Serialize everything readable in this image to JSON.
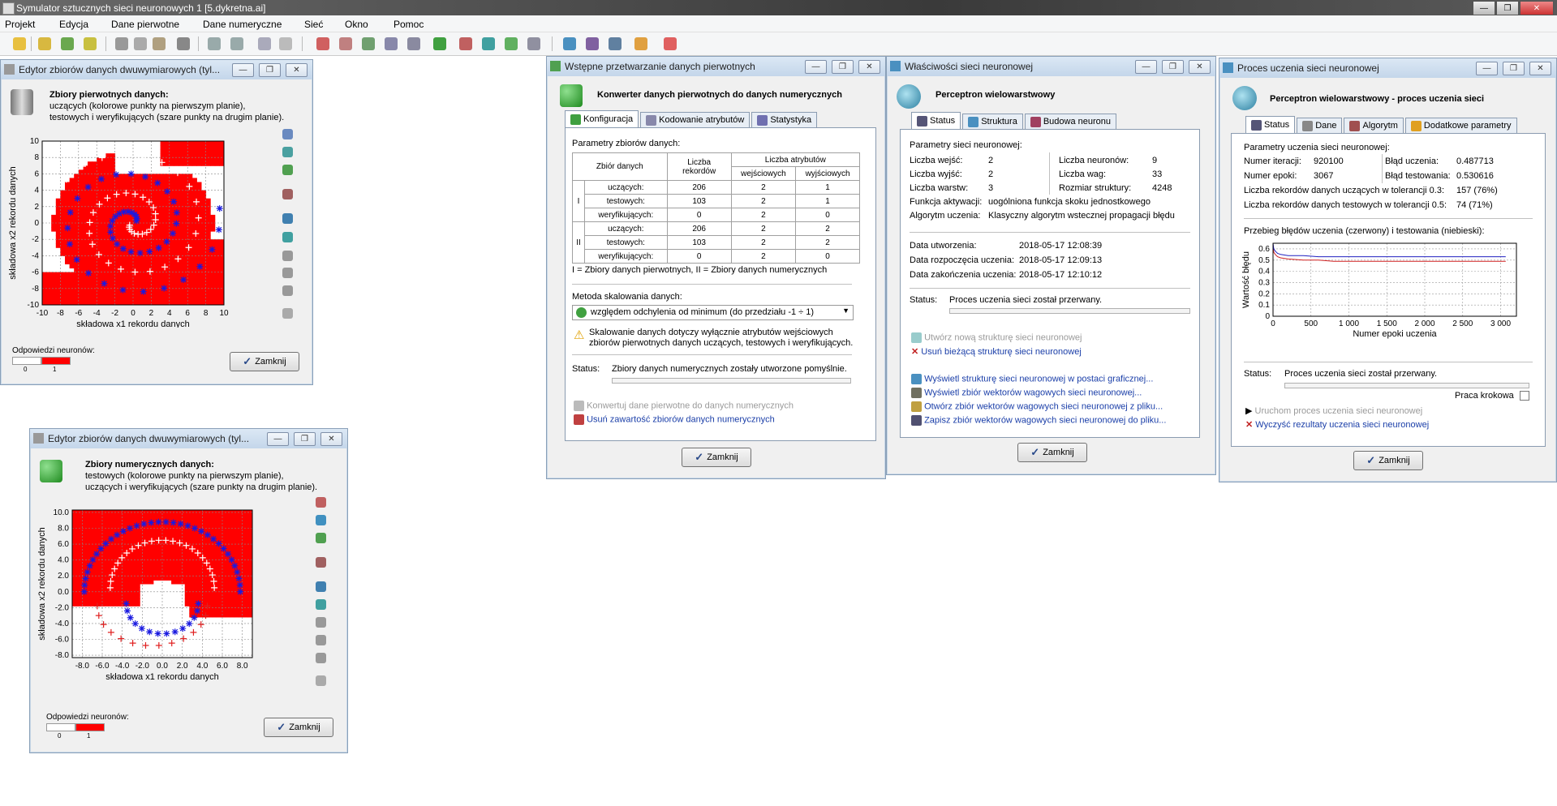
{
  "app": {
    "title": "Symulator sztucznych sieci neuronowych 1 [5.dykretna.ai]",
    "menu": [
      "Projekt",
      "Edycja",
      "Dane pierwotne",
      "Dane numeryczne",
      "Sieć",
      "Okno",
      "Pomoc"
    ]
  },
  "w1": {
    "title": "Edytor zbiorów danych dwuwymiarowych (tyl...",
    "heading": "Zbiory pierwotnych danych:",
    "desc1": "uczących (kolorowe punkty na pierwszym planie),",
    "desc2": "testowych i weryfikujących (szare punkty na drugim planie).",
    "xlabel": "składowa x1 rekordu danych",
    "ylabel": "składowa x2 rekordu danych",
    "xticks": [
      "-10",
      "-8",
      "-6",
      "-4",
      "-2",
      "0",
      "2",
      "4",
      "6",
      "8",
      "10"
    ],
    "yticks": [
      "10",
      "8",
      "6",
      "4",
      "2",
      "0",
      "-2",
      "-4",
      "-6",
      "-8",
      "-10"
    ],
    "legend_label": "Odpowiedzi neuronów:",
    "legend_0": "0",
    "legend_1": "1",
    "close": "Zamknij"
  },
  "w2": {
    "title": "Edytor zbiorów danych dwuwymiarowych (tyl...",
    "heading": "Zbiory numerycznych danych:",
    "desc1": "testowych (kolorowe punkty na pierwszym planie),",
    "desc2": "uczących i weryfikujących (szare punkty na drugim planie).",
    "xlabel": "składowa x1 rekordu danych",
    "ylabel": "składowa x2 rekordu danych",
    "xticks": [
      "-8.0",
      "-6.0",
      "-4.0",
      "-2.0",
      "0.0",
      "2.0",
      "4.0",
      "6.0",
      "8.0"
    ],
    "yticks": [
      "10.0",
      "8.0",
      "6.0",
      "4.0",
      "2.0",
      "0.0",
      "-2.0",
      "-4.0",
      "-6.0",
      "-8.0"
    ],
    "legend_label": "Odpowiedzi neuronów:",
    "legend_0": "0",
    "legend_1": "1",
    "close": "Zamknij"
  },
  "w3": {
    "title": "Wstępne przetwarzanie danych pierwotnych",
    "heading": "Konwerter danych pierwotnych do danych numerycznych",
    "tabs": [
      "Konfiguracja",
      "Kodowanie atrybutów",
      "Statystyka"
    ],
    "params_label": "Parametry zbiorów danych:",
    "col_set": "Zbiór danych",
    "col_records": "Liczba rekordów",
    "col_attrs": "Liczba atrybutów",
    "col_in": "wejściowych",
    "col_out": "wyjściowych",
    "group1": "I",
    "group2": "II",
    "rows": [
      {
        "name": "uczących:",
        "rec": "206",
        "in": "2",
        "out": "1"
      },
      {
        "name": "testowych:",
        "rec": "103",
        "in": "2",
        "out": "1"
      },
      {
        "name": "weryfikujących:",
        "rec": "0",
        "in": "2",
        "out": "0"
      },
      {
        "name": "uczących:",
        "rec": "206",
        "in": "2",
        "out": "2"
      },
      {
        "name": "testowych:",
        "rec": "103",
        "in": "2",
        "out": "2"
      },
      {
        "name": "weryfikujących:",
        "rec": "0",
        "in": "2",
        "out": "0"
      }
    ],
    "legend": "I = Zbiory danych pierwotnych, II = Zbiory danych numerycznych",
    "scaling_label": "Metoda skalowania danych:",
    "scaling_value": "względem odchylenia od minimum (do przedziału -1 ÷ 1)",
    "warn1": "Skalowanie danych dotyczy wyłącznie atrybutów wejściowych",
    "warn2": "zbiorów pierwotnych danych uczących, testowych i weryfikujących.",
    "status_label": "Status:",
    "status_value": "Zbiory danych numerycznych zostały utworzone pomyślnie.",
    "action1": "Konwertuj dane pierwotne do danych numerycznych",
    "action2": "Usuń zawartość zbiorów danych numerycznych",
    "close": "Zamknij"
  },
  "w4": {
    "title": "Właściwości sieci neuronowej",
    "heading": "Perceptron wielowarstwowy",
    "tabs": [
      "Status",
      "Struktura",
      "Budowa neuronu"
    ],
    "params_label": "Parametry sieci neuronowej:",
    "inputs_label": "Liczba wejść:",
    "inputs": "2",
    "outputs_label": "Liczba wyjść:",
    "outputs": "2",
    "layers_label": "Liczba warstw:",
    "layers": "3",
    "neurons_label": "Liczba neuronów:",
    "neurons": "9",
    "weights_label": "Liczba wag:",
    "weights": "33",
    "size_label": "Rozmiar struktury:",
    "size": "4248",
    "activation_label": "Funkcja aktywacji:",
    "activation": "uogólniona funkcja skoku jednostkowego",
    "algo_label": "Algorytm uczenia:",
    "algo": "Klasyczny algorytm wstecznej propagacji błędu",
    "created_label": "Data utworzenia:",
    "created": "2018-05-17 12:08:39",
    "started_label": "Data rozpoczęcia uczenia:",
    "started": "2018-05-17 12:09:13",
    "ended_label": "Data zakończenia uczenia:",
    "ended": "2018-05-17 12:10:12",
    "status_label": "Status:",
    "status_value": "Proces uczenia sieci został przerwany.",
    "action1": "Utwórz nową strukturę sieci neuronowej",
    "action2": "Usuń bieżącą strukturę sieci neuronowej",
    "action3": "Wyświetl strukturę sieci neuronowej w postaci graficznej...",
    "action4": "Wyświetl zbiór wektorów wagowych sieci neuronowej...",
    "action5": "Otwórz zbiór wektorów wagowych sieci neuronowej z pliku...",
    "action6": "Zapisz zbiór wektorów wagowych sieci neuronowej do pliku...",
    "close": "Zamknij"
  },
  "w5": {
    "title": "Proces uczenia sieci neuronowej",
    "heading": "Perceptron wielowarstwowy - proces uczenia sieci",
    "tabs": [
      "Status",
      "Dane",
      "Algorytm",
      "Dodatkowe parametry"
    ],
    "params_label": "Parametry uczenia sieci neuronowej:",
    "iter_label": "Numer iteracji:",
    "iter": "920100",
    "epoch_label": "Numer epoki:",
    "epoch": "3067",
    "err_train_label": "Błąd uczenia:",
    "err_train": "0.487713",
    "err_test_label": "Błąd testowania:",
    "err_test": "0.530616",
    "tol_train_label": "Liczba rekordów danych uczących w tolerancji 0.3:",
    "tol_train": "157 (76%)",
    "tol_test_label": "Liczba rekordów danych testowych w tolerancji 0.5:",
    "tol_test": "74 (71%)",
    "chart_label": "Przebieg błędów uczenia (czerwony) i testowania (niebieski):",
    "status_label": "Status:",
    "status_value": "Proces uczenia sieci został przerwany.",
    "step_label": "Praca krokowa",
    "action1": "Uruchom proces uczenia sieci neuronowej",
    "action2": "Wyczyść rezultaty uczenia sieci neuronowej",
    "close": "Zamknij"
  },
  "chart_data": [
    {
      "type": "line",
      "xlabel": "Numer epoki uczenia",
      "ylabel": "Wartość błędu",
      "xlim": [
        0,
        3000
      ],
      "ylim": [
        0,
        0.65
      ],
      "xticks": [
        "0",
        "500",
        "1 000",
        "1 500",
        "2 000",
        "2 500",
        "3 000"
      ],
      "yticks": [
        "0.6",
        "0.5",
        "0.4",
        "0.3",
        "0.2",
        "0.1",
        "0"
      ],
      "grid": true,
      "series": [
        {
          "color": "#d02020",
          "x": [
            0,
            10,
            30,
            60,
            100,
            200,
            400,
            600,
            800,
            1000,
            1200,
            1500,
            2000,
            2500,
            3000,
            3067
          ],
          "y": [
            0.64,
            0.57,
            0.55,
            0.53,
            0.52,
            0.51,
            0.5,
            0.5,
            0.49,
            0.49,
            0.49,
            0.49,
            0.49,
            0.49,
            0.49,
            0.49
          ]
        },
        {
          "color": "#2020c0",
          "x": [
            0,
            10,
            30,
            60,
            100,
            200,
            400,
            600,
            800,
            1000,
            1200,
            1500,
            2000,
            2500,
            3000,
            3067
          ],
          "y": [
            0.65,
            0.6,
            0.58,
            0.56,
            0.55,
            0.54,
            0.54,
            0.53,
            0.53,
            0.53,
            0.53,
            0.53,
            0.53,
            0.53,
            0.53,
            0.53
          ]
        }
      ]
    }
  ]
}
